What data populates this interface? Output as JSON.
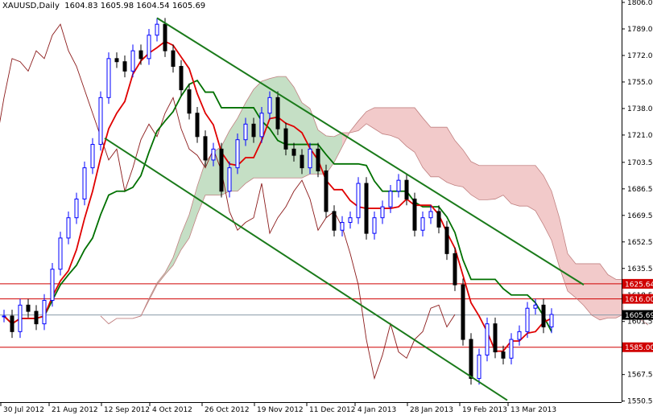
{
  "header": {
    "symbol_label": "XAUUSD,Daily",
    "ohlc": "1604.83 1605.98 1604.54 1605.69"
  },
  "colors": {
    "bull": "#0000ff",
    "bear": "#000000",
    "tenkan": "#e00000",
    "kijun": "#007000",
    "chikou": "#8b1a1a",
    "cloud_up": "#2e8b2e",
    "cloud_down": "#d04040",
    "channel": "#1a7a1a",
    "level": "#d00000",
    "price_tag": "#000000"
  },
  "chart_data": {
    "type": "candlestick",
    "title": "XAUUSD,Daily",
    "indicators": [
      "Ichimoku Kinko Hyo"
    ],
    "ylim": [
      1550.5,
      1806.0
    ],
    "y_ticks": [
      "1806.00",
      "1789.00",
      "1772.00",
      "1755.00",
      "1738.00",
      "1721.00",
      "1703.50",
      "1686.50",
      "1669.50",
      "1652.50",
      "1635.50",
      "1618.50",
      "1601.50",
      "1567.50",
      "1550.50"
    ],
    "x_labels": [
      "30 Jul 2012",
      "21 Aug 2012",
      "12 Sep 2012",
      "4 Oct 2012",
      "26 Oct 2012",
      "19 Nov 2012",
      "11 Dec 2012",
      "4 Jan 2013",
      "28 Jan 2013",
      "19 Feb 2013",
      "13 Mar 2013"
    ],
    "x_label_bar_index": [
      0,
      6,
      12.5,
      18.5,
      25,
      31.5,
      38,
      44,
      50.5,
      57,
      63
    ],
    "closes": [
      1605,
      1595,
      1612,
      1608,
      1600,
      1615,
      1635,
      1655,
      1668,
      1680,
      1700,
      1715,
      1745,
      1770,
      1768,
      1762,
      1775,
      1770,
      1785,
      1792,
      1775,
      1765,
      1750,
      1735,
      1720,
      1705,
      1712,
      1685,
      1700,
      1718,
      1728,
      1720,
      1735,
      1745,
      1725,
      1712,
      1708,
      1700,
      1712,
      1698,
      1672,
      1660,
      1665,
      1668,
      1690,
      1658,
      1668,
      1675,
      1685,
      1692,
      1680,
      1660,
      1668,
      1672,
      1662,
      1645,
      1625,
      1590,
      1565,
      1580,
      1600,
      1582,
      1578,
      1590,
      1595,
      1610,
      1612,
      1598,
      1606
    ],
    "channel_lines": [
      {
        "name": "upper",
        "from": {
          "bar": 19,
          "price": 1796
        },
        "to": {
          "bar": 72,
          "price": 1625
        }
      },
      {
        "name": "lower",
        "from": {
          "bar": 12.5,
          "price": 1719
        },
        "to": {
          "bar": 62.5,
          "price": 1551
        }
      }
    ],
    "levels": [
      {
        "price": 1625.64,
        "label": "1625.64",
        "style": "level"
      },
      {
        "price": 1616.0,
        "label": "1616.00",
        "style": "level"
      },
      {
        "price": 1585.0,
        "label": "1585.00",
        "style": "level"
      },
      {
        "price": 1605.69,
        "label": "1605.69",
        "style": "current"
      }
    ]
  }
}
